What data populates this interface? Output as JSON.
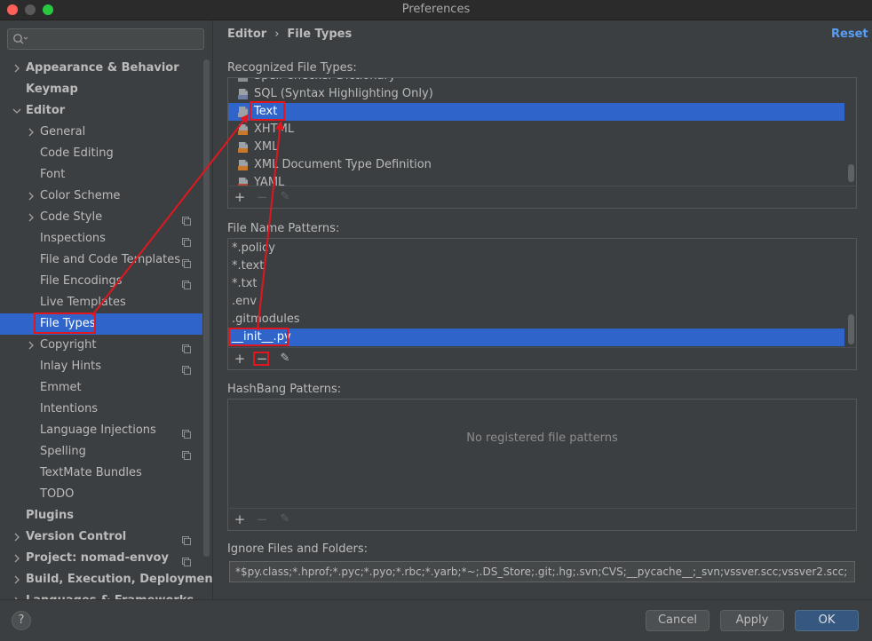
{
  "window": {
    "title": "Preferences"
  },
  "sidebar": {
    "search_placeholder": "",
    "items": [
      {
        "label": "Appearance & Behavior",
        "bold": true,
        "arrow": "right"
      },
      {
        "label": "Keymap",
        "bold": true,
        "arrow": "none"
      },
      {
        "label": "Editor",
        "bold": true,
        "arrow": "down"
      },
      {
        "label": "General",
        "bold": false,
        "arrow": "right"
      },
      {
        "label": "Code Editing",
        "bold": false,
        "arrow": "none"
      },
      {
        "label": "Font",
        "bold": false,
        "arrow": "none"
      },
      {
        "label": "Color Scheme",
        "bold": false,
        "arrow": "right"
      },
      {
        "label": "Code Style",
        "bold": false,
        "arrow": "right",
        "copy": true
      },
      {
        "label": "Inspections",
        "bold": false,
        "arrow": "none",
        "copy": true
      },
      {
        "label": "File and Code Templates",
        "bold": false,
        "arrow": "none",
        "copy": true
      },
      {
        "label": "File Encodings",
        "bold": false,
        "arrow": "none",
        "copy": true
      },
      {
        "label": "Live Templates",
        "bold": false,
        "arrow": "none"
      },
      {
        "label": "File Types",
        "bold": false,
        "arrow": "none",
        "selected": true
      },
      {
        "label": "Copyright",
        "bold": false,
        "arrow": "right",
        "copy": true
      },
      {
        "label": "Inlay Hints",
        "bold": false,
        "arrow": "none",
        "copy": true
      },
      {
        "label": "Emmet",
        "bold": false,
        "arrow": "none"
      },
      {
        "label": "Intentions",
        "bold": false,
        "arrow": "none"
      },
      {
        "label": "Language Injections",
        "bold": false,
        "arrow": "none",
        "copy": true
      },
      {
        "label": "Spelling",
        "bold": false,
        "arrow": "none",
        "copy": true
      },
      {
        "label": "TextMate Bundles",
        "bold": false,
        "arrow": "none"
      },
      {
        "label": "TODO",
        "bold": false,
        "arrow": "none"
      },
      {
        "label": "Plugins",
        "bold": true,
        "arrow": "none"
      },
      {
        "label": "Version Control",
        "bold": true,
        "arrow": "right",
        "copy": true
      },
      {
        "label": "Project: nomad-envoy",
        "bold": true,
        "arrow": "right",
        "copy": true
      },
      {
        "label": "Build, Execution, Deployment",
        "bold": true,
        "arrow": "right"
      },
      {
        "label": "Languages & Frameworks",
        "bold": true,
        "arrow": "right"
      }
    ]
  },
  "breadcrumb": {
    "parent": "Editor",
    "separator": "›",
    "current": "File Types"
  },
  "reset_label": "Reset",
  "recognized": {
    "label": "Recognized File Types:",
    "items": [
      {
        "label": "Spell Checker Dictionary",
        "icon": "dictionary-file-icon"
      },
      {
        "label": "SQL (Syntax Highlighting Only)",
        "icon": "sql-file-icon"
      },
      {
        "label": "Text",
        "icon": "text-file-icon",
        "selected": true
      },
      {
        "label": "XHTML",
        "icon": "xhtml-file-icon"
      },
      {
        "label": "XML",
        "icon": "xml-file-icon"
      },
      {
        "label": "XML Document Type Definition",
        "icon": "dtd-file-icon"
      },
      {
        "label": "YAML",
        "icon": "yaml-file-icon"
      }
    ]
  },
  "patterns": {
    "label": "File Name Patterns:",
    "items": [
      {
        "label": "*.policy"
      },
      {
        "label": "*.text"
      },
      {
        "label": "*.txt"
      },
      {
        "label": ".env"
      },
      {
        "label": ".gitmodules"
      },
      {
        "label": "__init__.py",
        "selected": true
      }
    ]
  },
  "hashbang": {
    "label": "HashBang Patterns:",
    "empty_text": "No registered file patterns"
  },
  "ignore": {
    "label": "Ignore Files and Folders:",
    "value": "*$py.class;*.hprof;*.pyc;*.pyo;*.rbc;*.yarb;*~;.DS_Store;.git;.hg;.svn;CVS;__pycache__;_svn;vssver.scc;vssver2.scc;"
  },
  "toolbar": {
    "add": "+",
    "remove": "−",
    "edit": "✎"
  },
  "buttons": {
    "help": "?",
    "cancel": "Cancel",
    "apply": "Apply",
    "ok": "OK"
  },
  "colors": {
    "selection": "#2f65ca",
    "accent": "#589df6",
    "annotation": "#e0171f",
    "ok_button": "#365880"
  }
}
